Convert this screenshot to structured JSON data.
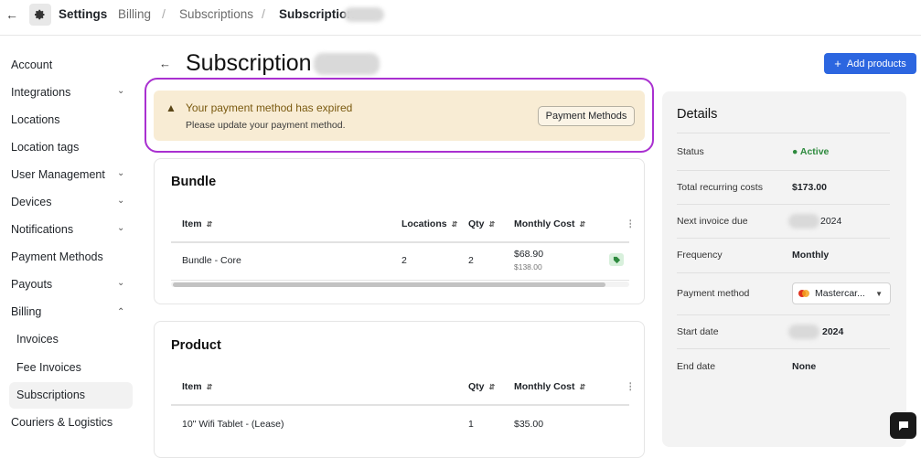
{
  "topbar": {
    "settings": "Settings",
    "crumbs": [
      "Billing",
      "Subscriptions",
      "Subscription"
    ],
    "separator": "/"
  },
  "sidebar": {
    "items": [
      {
        "label": "Account",
        "chevron": ""
      },
      {
        "label": "Integrations",
        "chevron": "⌄"
      },
      {
        "label": "Locations",
        "chevron": ""
      },
      {
        "label": "Location tags",
        "chevron": ""
      },
      {
        "label": "User Management",
        "chevron": "⌄"
      },
      {
        "label": "Devices",
        "chevron": "⌄"
      },
      {
        "label": "Notifications",
        "chevron": "⌄"
      },
      {
        "label": "Payment Methods",
        "chevron": ""
      },
      {
        "label": "Payouts",
        "chevron": "⌄"
      },
      {
        "label": "Billing",
        "chevron": "⌃"
      },
      {
        "label": "Invoices",
        "chevron": ""
      },
      {
        "label": "Fee Invoices",
        "chevron": ""
      },
      {
        "label": "Subscriptions",
        "chevron": ""
      },
      {
        "label": "Couriers & Logistics",
        "chevron": "⌄"
      }
    ],
    "active": "Subscriptions"
  },
  "main": {
    "title": "Subscription",
    "add_button": "Add products"
  },
  "alert": {
    "title": "Your payment method has expired",
    "message": "Please update your payment method.",
    "button": "Payment Methods"
  },
  "bundle": {
    "title": "Bundle",
    "headers": {
      "item": "Item",
      "locations": "Locations",
      "qty": "Qty",
      "monthly_cost": "Monthly Cost"
    },
    "row": {
      "item": "Bundle - Core",
      "locations": "2",
      "qty": "2",
      "cost": "$68.90",
      "original_cost": "$138.00"
    }
  },
  "product": {
    "title": "Product",
    "headers": {
      "item": "Item",
      "qty": "Qty",
      "monthly_cost": "Monthly Cost"
    },
    "row": {
      "item": "10\" Wifi Tablet - (Lease)",
      "qty": "1",
      "cost": "$35.00"
    }
  },
  "details": {
    "title": "Details",
    "status_label": "Status",
    "status_value": "Active",
    "recurring_label": "Total recurring costs",
    "recurring_value": "$173.00",
    "next_invoice_label": "Next invoice due",
    "next_invoice_value": "2024",
    "frequency_label": "Frequency",
    "frequency_value": "Monthly",
    "payment_label": "Payment method",
    "payment_value": "Mastercar...",
    "start_label": "Start date",
    "start_value": "2024",
    "end_label": "End date",
    "end_value": "None"
  },
  "colors": {
    "accent": "#2c66e0",
    "alert_bg": "#f8ecd4",
    "highlight": "#a930d0",
    "active": "#2e8a3e"
  }
}
